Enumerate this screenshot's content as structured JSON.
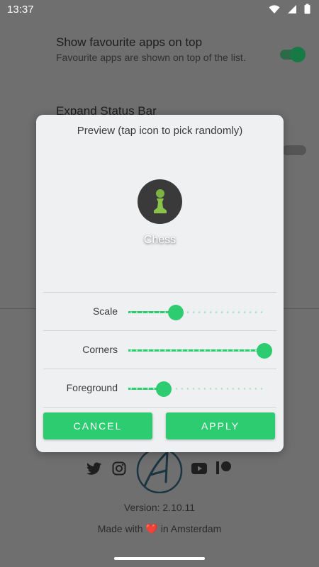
{
  "status_bar": {
    "time": "13:37"
  },
  "settings": {
    "fav_title": "Show favourite apps on top",
    "fav_sub": "Favourite apps are shown on top of the list.",
    "expand_title": "Expand Status Bar"
  },
  "dialog": {
    "title": "Preview (tap icon to pick randomly)",
    "app_label": "Chess",
    "sliders": [
      {
        "label": "Scale",
        "value": 0.35
      },
      {
        "label": "Corners",
        "value": 1.0
      },
      {
        "label": "Foreground",
        "value": 0.26
      }
    ],
    "cancel_label": "CANCEL",
    "apply_label": "APPLY"
  },
  "footer": {
    "version": "Version: 2.10.11",
    "made_with_pre": "Made with",
    "made_with_post": "in Amsterdam"
  },
  "colors": {
    "accent": "#2ecc71",
    "scrim": "#6f6f6f",
    "dialog_bg": "#eef0f1"
  }
}
